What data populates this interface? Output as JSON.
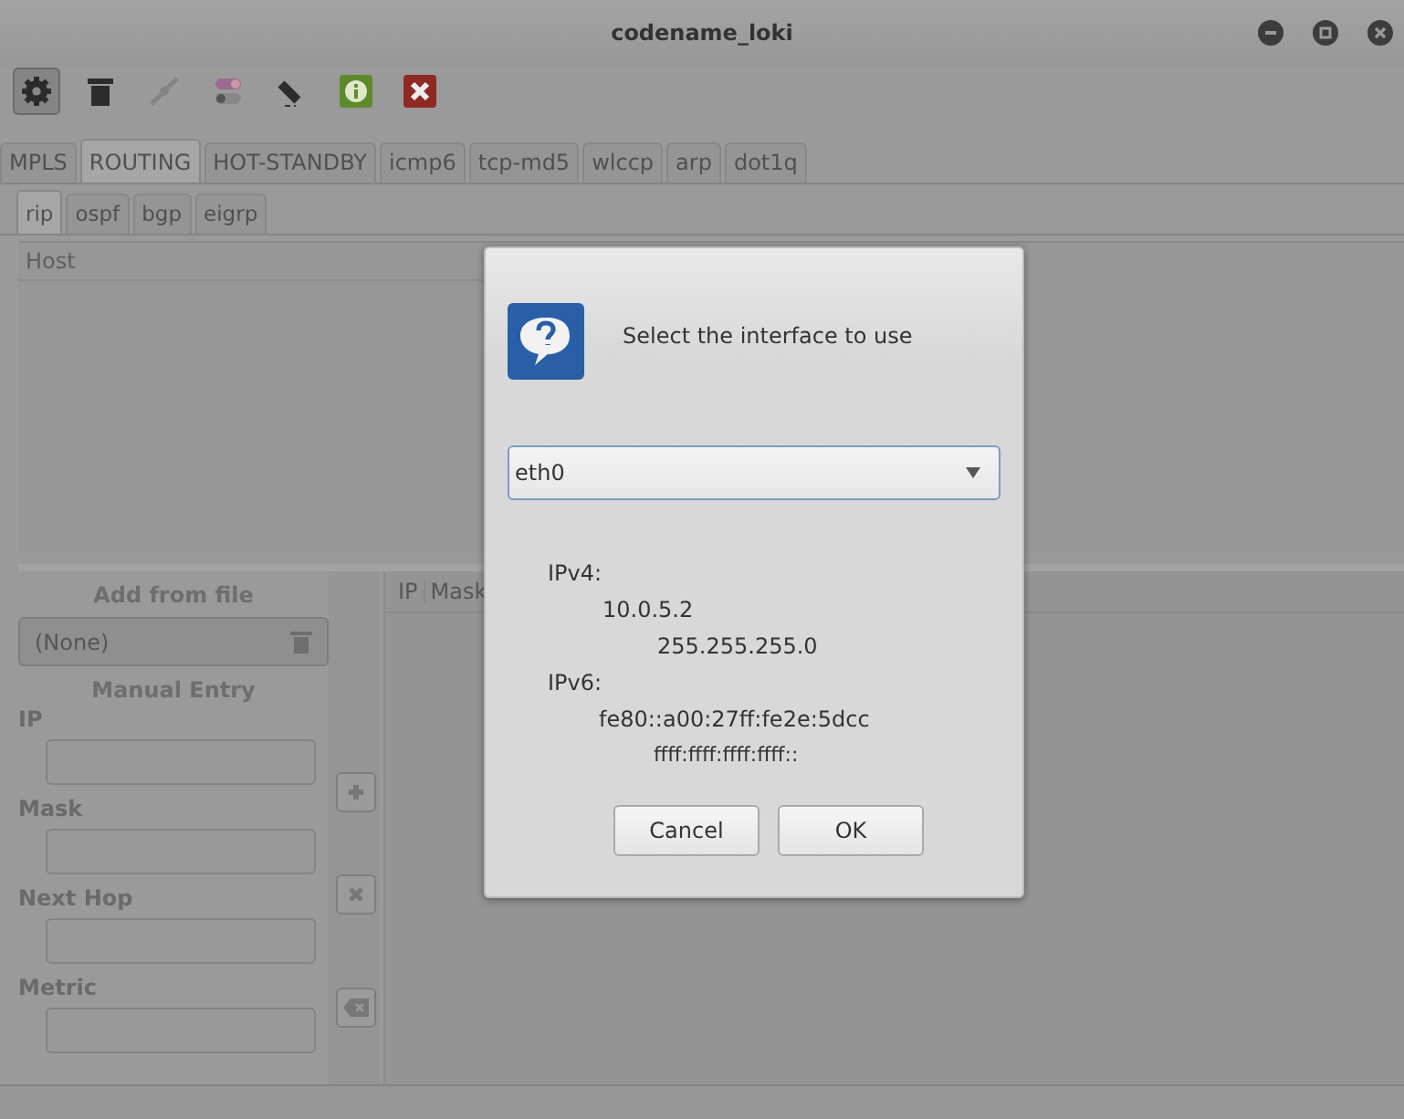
{
  "window": {
    "title": "codename_loki"
  },
  "toolbar": [
    {
      "kind": "gear",
      "pressed": true,
      "disabled": false
    },
    {
      "kind": "trash",
      "pressed": false,
      "disabled": false
    },
    {
      "kind": "plug",
      "pressed": false,
      "disabled": true
    },
    {
      "kind": "toggle",
      "pressed": false,
      "disabled": false
    },
    {
      "kind": "pen",
      "pressed": false,
      "disabled": false
    },
    {
      "kind": "info",
      "pressed": false,
      "disabled": false
    },
    {
      "kind": "close",
      "pressed": false,
      "disabled": false
    }
  ],
  "tabs": [
    {
      "label": "MPLS",
      "selected": false
    },
    {
      "label": "ROUTING",
      "selected": true
    },
    {
      "label": "HOT-STANDBY",
      "selected": false
    },
    {
      "label": "icmp6",
      "selected": false
    },
    {
      "label": "tcp-md5",
      "selected": false
    },
    {
      "label": "wlccp",
      "selected": false
    },
    {
      "label": "arp",
      "selected": false
    },
    {
      "label": "dot1q",
      "selected": false
    }
  ],
  "subtabs": [
    {
      "label": "rip",
      "selected": true
    },
    {
      "label": "ospf",
      "selected": false
    },
    {
      "label": "bgp",
      "selected": false
    },
    {
      "label": "eigrp",
      "selected": false
    }
  ],
  "host_list": {
    "header": "Host"
  },
  "left_panel": {
    "file_heading": "Add from file",
    "file_chooser": "(None)",
    "manual_heading": "Manual Entry",
    "fields": [
      {
        "label": "IP"
      },
      {
        "label": "Mask"
      },
      {
        "label": "Next Hop"
      },
      {
        "label": "Metric"
      }
    ]
  },
  "side_buttons": [
    {
      "kind": "add"
    },
    {
      "kind": "remove"
    },
    {
      "kind": "clear"
    }
  ],
  "table": {
    "columns": [
      "IP",
      "Mask"
    ]
  },
  "dialog": {
    "message": "Select the interface to use",
    "combo": "eth0",
    "lines": [
      {
        "text": "IPv4:",
        "kind": "heading"
      },
      {
        "text": "10.0.5.2",
        "kind": "address"
      },
      {
        "text": "255.255.255.0",
        "kind": "netmask"
      },
      {
        "text": "IPv6:",
        "kind": "heading"
      },
      {
        "text": "fe80::a00:27ff:fe2e:5dcc",
        "kind": "address6"
      },
      {
        "text": "ffff:ffff:ffff:ffff::",
        "kind": "netmask"
      }
    ],
    "buttons": [
      "Cancel",
      "OK"
    ]
  }
}
